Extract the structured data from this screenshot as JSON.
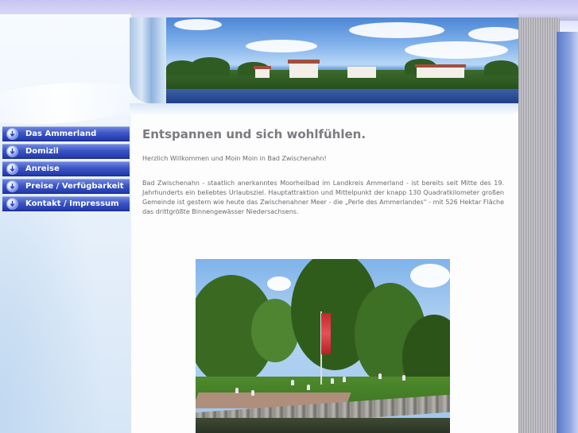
{
  "nav": {
    "items": [
      {
        "label": "Das Ammerland",
        "icon": "arrow-down-circle-icon"
      },
      {
        "label": "Domizil",
        "icon": "arrow-down-circle-icon"
      },
      {
        "label": "Anreise",
        "icon": "arrow-down-circle-icon"
      },
      {
        "label": "Preise / Verfügbarkeit",
        "icon": "arrow-down-circle-icon"
      },
      {
        "label": "Kontakt / Impressum",
        "icon": "arrow-down-circle-icon"
      }
    ]
  },
  "main": {
    "title": "Entspannen und sich wohlfühlen.",
    "intro": "Herzlich Willkommen und Moin Moin in Bad Zwischenahn!",
    "body": "Bad Zwischenahn - staatlich anerkanntes Moorheilbad im Landkreis Ammerland - ist bereits seit Mitte des 19. Jahrhunderts ein beliebtes Urlaubsziel. Hauptattraktion und Mittelpunkt der knapp 130 Quadratkilometer großen Gemeinde ist gestern wie heute das Zwischenahner Meer - die „Perle des Ammerlandes\" - mit 526 Hektar Fläche das drittgrößte Binnengewässer Niedersachsens."
  },
  "colors": {
    "nav_bg": "#2f48b8",
    "nav_text": "#ffffff",
    "title_text": "#7b7b80",
    "body_text": "#6c6c70",
    "page_top": "#c9c4f3"
  }
}
